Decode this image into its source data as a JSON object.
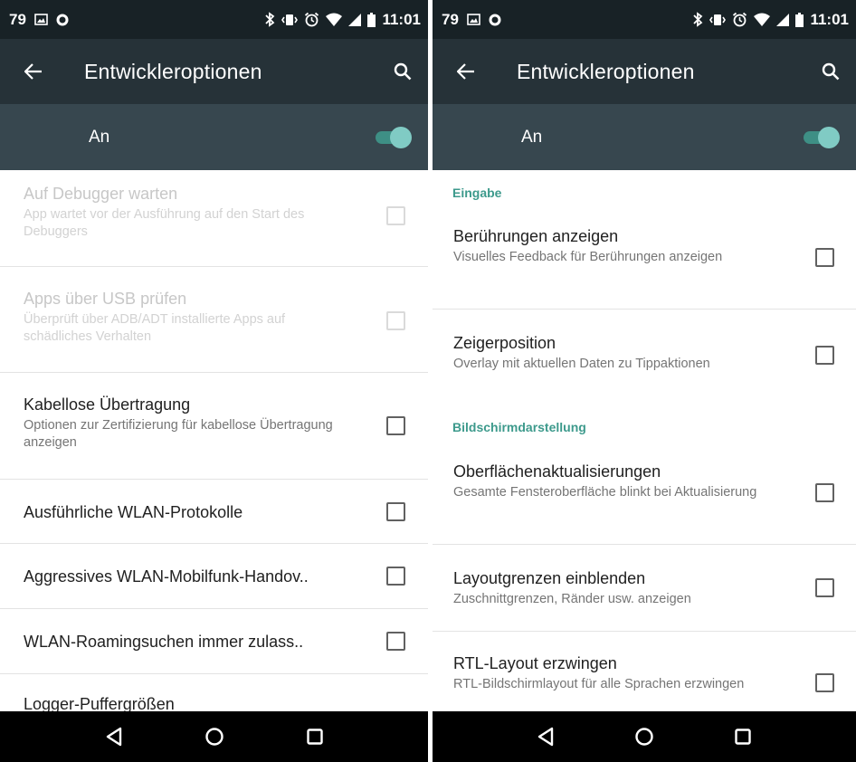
{
  "status_bar": {
    "notification_count": "79",
    "time": "11:01"
  },
  "toolbar": {
    "title": "Entwickleroptionen"
  },
  "master_switch": {
    "label": "An",
    "enabled": true,
    "accent_color": "#80cbc4"
  },
  "left_screen": {
    "items": [
      {
        "title": "Auf Debugger warten",
        "summary": "App wartet vor der Ausführung auf den Start des Debuggers",
        "enabled": false,
        "checked": false
      },
      {
        "title": "Apps über USB prüfen",
        "summary": "Überprüft über ADB/ADT installierte Apps auf schädliches Verhalten",
        "enabled": false,
        "checked": false
      },
      {
        "title": "Kabellose Übertragung",
        "summary": "Optionen zur Zertifizierung für kabellose Übertragung anzeigen",
        "enabled": true,
        "checked": false
      },
      {
        "title": "Ausführliche WLAN-Protokolle",
        "summary": "",
        "enabled": true,
        "checked": false
      },
      {
        "title": "Aggressives WLAN-Mobilfunk-Handov..",
        "summary": "",
        "enabled": true,
        "checked": false
      },
      {
        "title": "WLAN-Roamingsuchen immer zulass..",
        "summary": "",
        "enabled": true,
        "checked": false
      },
      {
        "title": "Logger-Puffergrößen",
        "summary": "",
        "enabled": true,
        "checked": false
      }
    ]
  },
  "right_screen": {
    "categories": [
      {
        "title": "Eingabe",
        "items": [
          {
            "title": "Berührungen anzeigen",
            "summary": "Visuelles Feedback für Berührungen anzeigen",
            "checked": false
          },
          {
            "title": "Zeigerposition",
            "summary": "Overlay mit aktuellen Daten zu Tippaktionen",
            "checked": false
          }
        ]
      },
      {
        "title": "Bildschirmdarstellung",
        "items": [
          {
            "title": "Oberflächenaktualisierungen",
            "summary": "Gesamte Fensteroberfläche blinkt bei Aktualisierung",
            "checked": false
          },
          {
            "title": "Layoutgrenzen einblenden",
            "summary": "Zuschnittgrenzen, Ränder usw. anzeigen",
            "checked": false
          },
          {
            "title": "RTL-Layout erzwingen",
            "summary": "RTL-Bildschirmlayout für alle Sprachen erzwingen",
            "checked": false
          }
        ]
      }
    ]
  },
  "icons": {
    "status_left": [
      "image-icon",
      "sync-icon"
    ],
    "status_right": [
      "bluetooth-icon",
      "vibrate-icon",
      "alarm-icon",
      "wifi-icon",
      "signal-icon",
      "battery-icon"
    ],
    "toolbar": [
      "back-arrow-icon",
      "search-icon"
    ],
    "nav": [
      "back-triangle-icon",
      "home-circle-icon",
      "recents-square-icon"
    ]
  },
  "colors": {
    "status_bar": "#182226",
    "toolbar": "#263238",
    "master_bar": "#37474f",
    "category_text": "#3d9a8c"
  }
}
